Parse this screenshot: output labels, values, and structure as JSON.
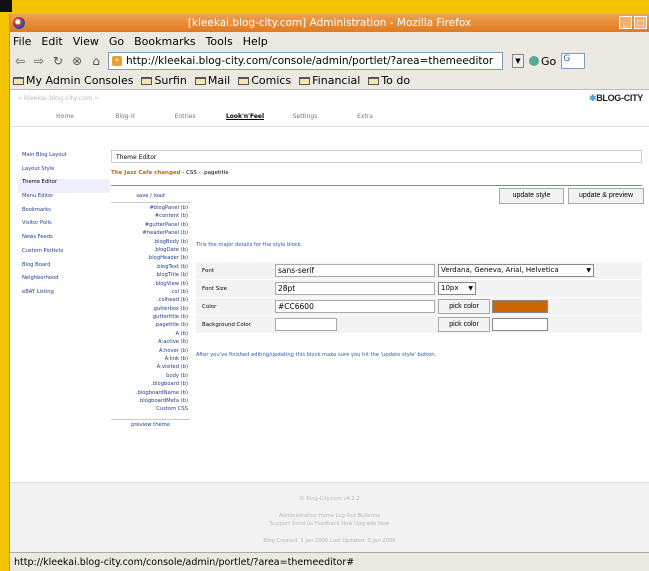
{
  "window": {
    "title": "[kleekai.blog-city.com] Administration - Mozilla Firefox"
  },
  "menu": [
    "File",
    "Edit",
    "View",
    "Go",
    "Bookmarks",
    "Tools",
    "Help"
  ],
  "navbar": {
    "url": "http://kleekai.blog-city.com/console/admin/portlet/?area=themeeditor",
    "go_label": "Go"
  },
  "bookmarks": [
    "My Admin Consoles",
    "Surfin",
    "Mail",
    "Comics",
    "Financial",
    "To do"
  ],
  "site": {
    "breadcrumb": "» kleekai.blog-city.com »",
    "logo": "BLOG-CITY"
  },
  "tabs": [
    "Home",
    "Blog-it",
    "Entries",
    "Look'n'Feel",
    "Settings",
    "Extra"
  ],
  "sidebar": [
    "Main Blog Layout",
    "Layout Style",
    "Theme Editor",
    "Menu Editor",
    "Bookmarks",
    "Visitor Polls",
    "News Feeds",
    "Custom Portlets",
    "Blog Board",
    "Neighborhood",
    "eBAY Listing"
  ],
  "editor": {
    "box_title": "Theme Editor",
    "theme_name": "The Jazz Cafe changed",
    "css_path": " - CSS - .pagetitle",
    "update_style": "update style",
    "update_preview": "update & preview",
    "save_load": "save / load",
    "preview_theme": "preview theme",
    "styles": [
      "#blogPanel (b)",
      "#content (b)",
      "#gutterPanel (b)",
      "#headerPanel (b)",
      ".blogBody (b)",
      ".blogDate (b)",
      ".blogHeader (b)",
      ".blogText (b)",
      ".blogTitle (b)",
      ".blogView (b)",
      ".col (b)",
      ".colhead (b)",
      ".gutterbox (b)",
      ".guttertitle (b)",
      ".pagetitle (b)",
      "A (b)",
      "A:active (b)",
      "A:hover (b)",
      "A:link (b)",
      "A:visited (b)",
      "body (b)",
      ".blogboard (b)",
      ".blogboardName (b)",
      ".blogboardMeta (b)",
      "Custom CSS"
    ],
    "detail_note": "This the major details for the style block.",
    "after_note": "After you've finished editing/updating this block make sure you hit the 'update style' button.",
    "labels": {
      "font": "Font",
      "size": "Font Size",
      "color": "Color",
      "bg": "Background Color"
    },
    "values": {
      "font": "sans-serif",
      "font_select": "Verdana, Geneva, Arial, Helvetica",
      "size": "28pt",
      "size_select": "10px",
      "color": "#CC6600",
      "bg": ""
    },
    "pick_color": "pick color",
    "swatch_color": "#CC6600",
    "swatch_empty": "#ffffff"
  },
  "footer": {
    "version": "© Blog-City.com v4.2.2",
    "links1": "Administration Home   Log Out   Bulletins",
    "links2": "Support   Send Us Feedback Now   Upgrade Now",
    "dates": "Blog Created: 5 Jan 2006   Last Updated: 5 Jan 2006"
  },
  "status": {
    "text": "http://kleekai.blog-city.com/console/admin/portlet/?area=themeeditor#"
  }
}
